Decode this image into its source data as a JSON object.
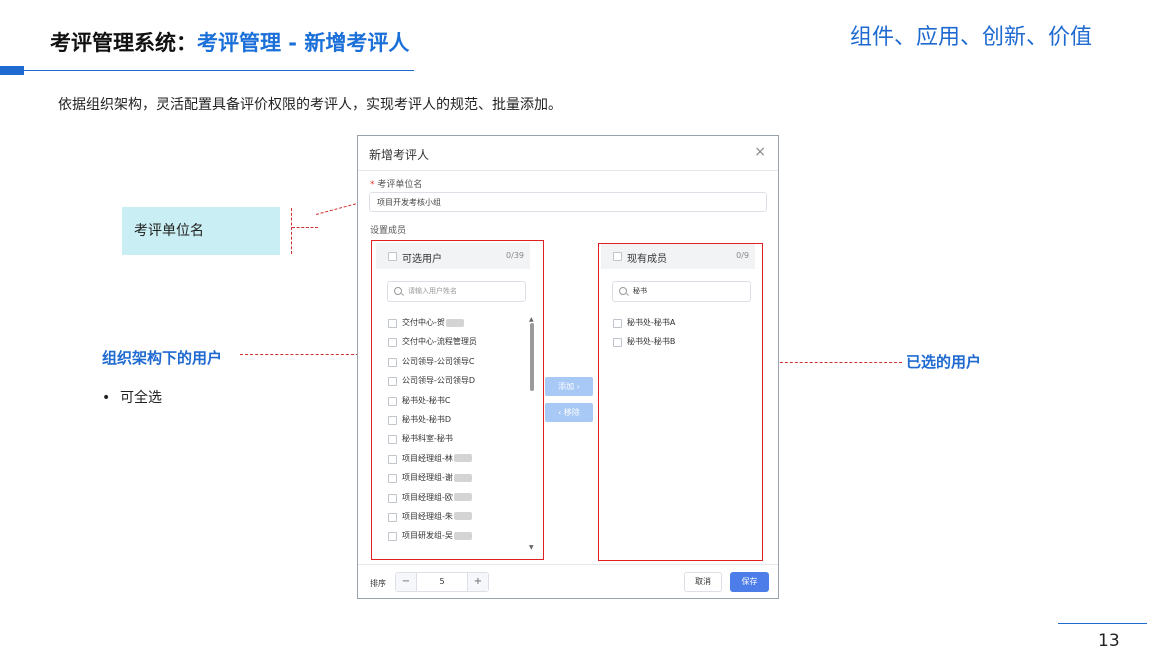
{
  "slide": {
    "title_prefix": "考评管理系统：",
    "title_highlight": "考评管理 - 新增考评人",
    "slogan": "组件、应用、创新、价值",
    "description": "依据组织架构，灵活配置具备评价权限的考评人，实现考评人的规范、批量添加。",
    "page_number": "13",
    "accent_color": "#1f6ad0"
  },
  "callouts": {
    "unit_name": "考评单位名",
    "org_users": "组织架构下的用户",
    "selected_users": "已选的用户",
    "bullet_marker": "•",
    "bullet_select_all": "可全选",
    "arrow_color": "#d03030"
  },
  "dialog": {
    "title": "新增考评人",
    "close_icon": "×",
    "unit_field": {
      "required_mark": "*",
      "label": "考评单位名",
      "value": "项目开发考核小组"
    },
    "members_label": "设置成员",
    "available": {
      "title": "可选用户",
      "count": "0/39",
      "search_placeholder": "请输入用户姓名",
      "items": [
        {
          "label": "交付中心-贺",
          "blurred": true
        },
        {
          "label": "交付中心-流程管理员",
          "blurred": false
        },
        {
          "label": "公司领导-公司领导C",
          "blurred": false
        },
        {
          "label": "公司领导-公司领导D",
          "blurred": false
        },
        {
          "label": "秘书处-秘书C",
          "blurred": false
        },
        {
          "label": "秘书处-秘书D",
          "blurred": false
        },
        {
          "label": "秘书科室-秘书",
          "blurred": false
        },
        {
          "label": "项目经理组-林",
          "blurred": true
        },
        {
          "label": "项目经理组-谢",
          "blurred": true
        },
        {
          "label": "项目经理组-欧",
          "blurred": true
        },
        {
          "label": "项目经理组-朱",
          "blurred": true
        },
        {
          "label": "项目研发组-吴",
          "blurred": true
        }
      ]
    },
    "transfer": {
      "add_label": "添加 ›",
      "remove_label": "‹ 移除"
    },
    "selected": {
      "title": "现有成员",
      "count": "0/9",
      "search_value": "秘书",
      "items": [
        {
          "label": "秘书处-秘书A"
        },
        {
          "label": "秘书处-秘书B"
        }
      ]
    },
    "footer": {
      "sort_label": "排序",
      "minus": "−",
      "sort_value": "5",
      "plus": "+",
      "cancel_label": "取消",
      "save_label": "保存",
      "save_color": "#4c7de8"
    }
  }
}
